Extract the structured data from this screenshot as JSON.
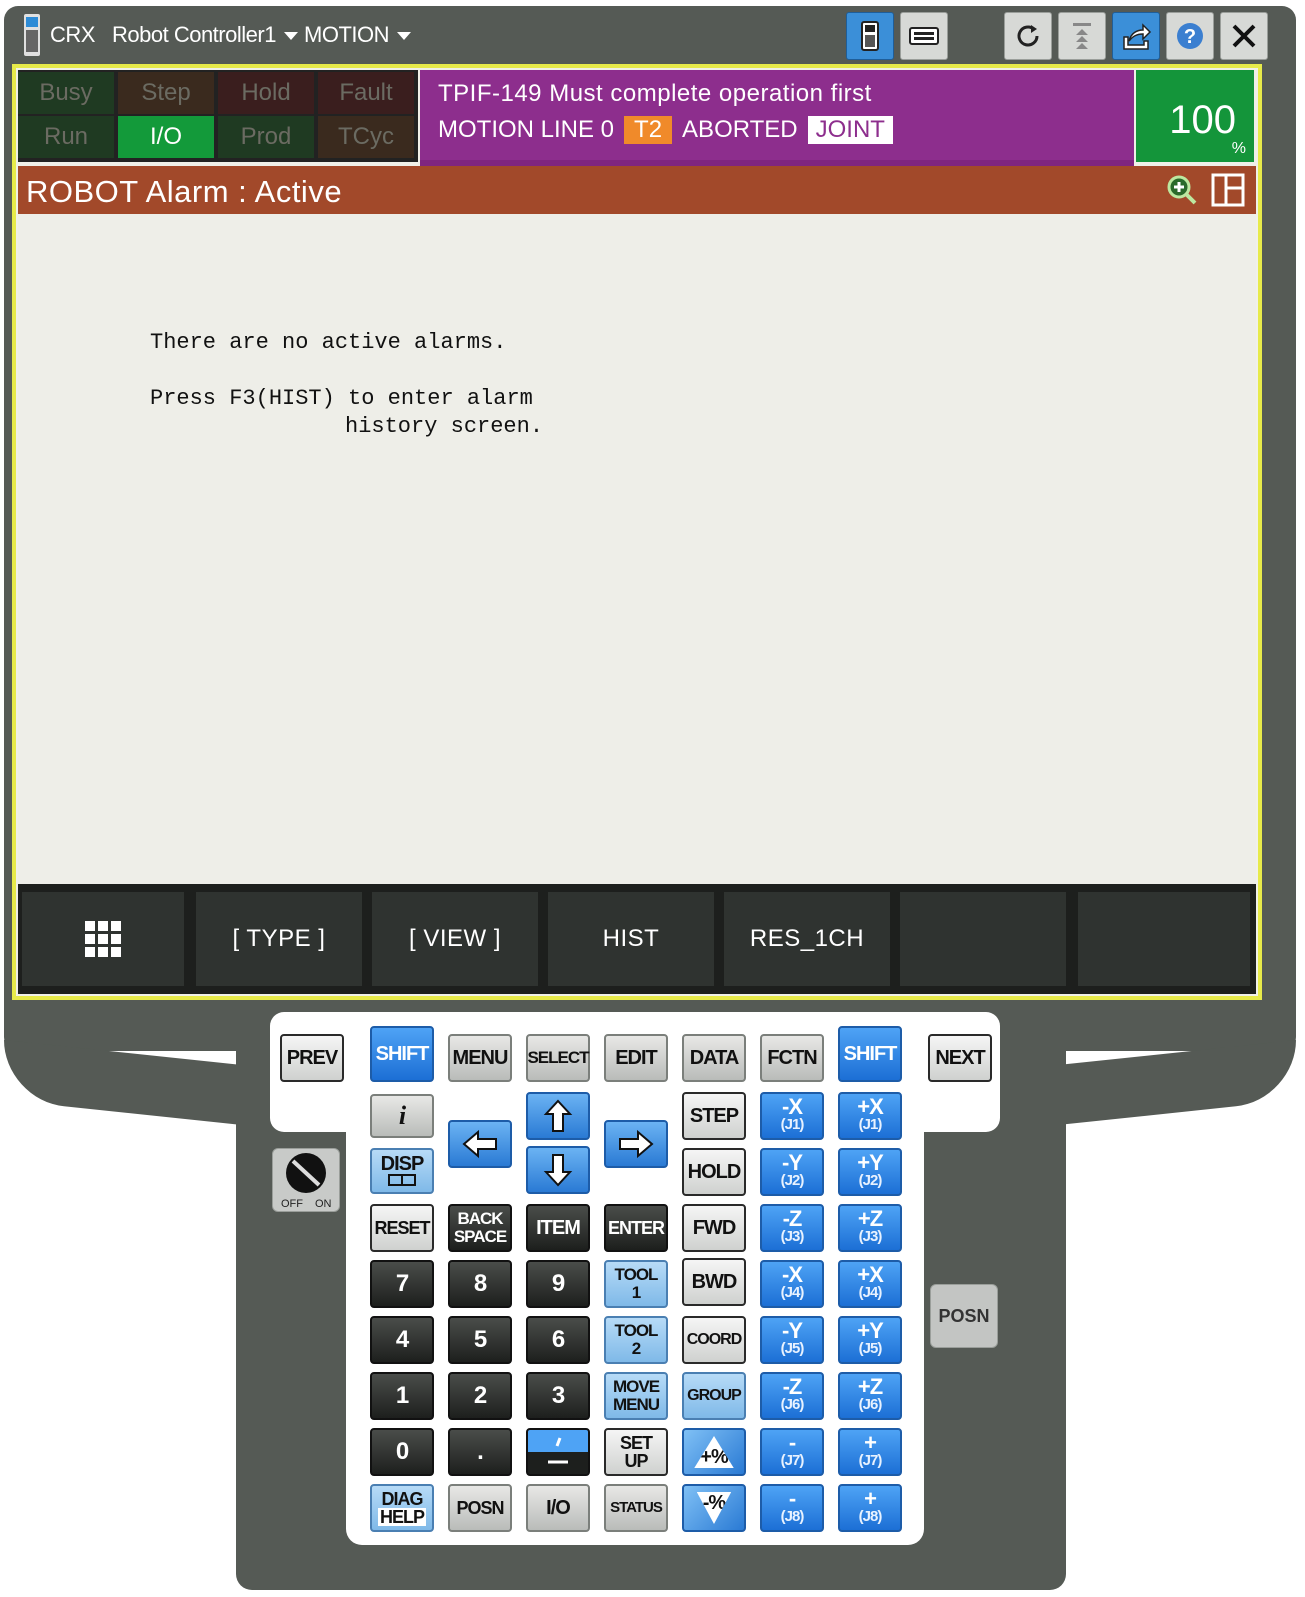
{
  "titlebar": {
    "app": "CRX",
    "controller": "Robot Controller1",
    "mode": "MOTION",
    "buttons": [
      "tp-icon",
      "keyboard-icon",
      "refresh-icon",
      "jog-icon",
      "share-icon",
      "help-icon",
      "close-icon"
    ]
  },
  "status": {
    "busy": "Busy",
    "step": "Step",
    "hold": "Hold",
    "fault": "Fault",
    "run": "Run",
    "io": "I/O",
    "prod": "Prod",
    "tcyc": "TCyc"
  },
  "message": {
    "line1": "TPIF-149 Must complete operation first",
    "motion": "MOTION LINE 0",
    "t2": "T2",
    "aborted": "ABORTED",
    "joint": "JOINT"
  },
  "override": {
    "value": "100",
    "unit": "%"
  },
  "screen": {
    "title": "ROBOT Alarm : Active",
    "line1": "There are no active alarms.",
    "line2": "Press F3(HIST) to enter alarm",
    "line3": "history screen."
  },
  "fkeys": [
    "",
    "[ TYPE ]",
    "[ VIEW ]",
    "HIST",
    "RES_1CH",
    "",
    ""
  ],
  "keys": {
    "prev": "PREV",
    "shift": "SHIFT",
    "menu": "MENU",
    "select": "SELECT",
    "edit": "EDIT",
    "data": "DATA",
    "fctn": "FCTN",
    "next": "NEXT",
    "info": "i",
    "disp": "DISP",
    "step": "STEP",
    "hold": "HOLD",
    "reset": "RESET",
    "backspace_1": "BACK",
    "backspace_2": "SPACE",
    "item": "ITEM",
    "enter": "ENTER",
    "fwd": "FWD",
    "bwd": "BWD",
    "n7": "7",
    "n8": "8",
    "n9": "9",
    "n4": "4",
    "n5": "5",
    "n6": "6",
    "n1": "1",
    "n2": "2",
    "n3": "3",
    "n0": "0",
    "dot": ".",
    "tool1_a": "TOOL",
    "tool1_b": "1",
    "tool2_a": "TOOL",
    "tool2_b": "2",
    "coord": "COORD",
    "move_a": "MOVE",
    "move_b": "MENU",
    "group": "GROUP",
    "setup_a": "SET",
    "setup_b": "UP",
    "plus_pct": "+%",
    "minus_pct": "-%",
    "diag_a": "DIAG",
    "diag_b": "HELP",
    "posn": "POSN",
    "io": "I/O",
    "status": "STATUS",
    "switch_off": "OFF",
    "switch_on": "ON",
    "posn_side": "POSN",
    "jog": [
      {
        "l": "-X",
        "s": "(J1)"
      },
      {
        "l": "+X",
        "s": "(J1)"
      },
      {
        "l": "-Y",
        "s": "(J2)"
      },
      {
        "l": "+Y",
        "s": "(J2)"
      },
      {
        "l": "-Z",
        "s": "(J3)"
      },
      {
        "l": "+Z",
        "s": "(J3)"
      },
      {
        "l": "-X",
        "s": "(J4)"
      },
      {
        "l": "+X",
        "s": "(J4)"
      },
      {
        "l": "-Y",
        "s": "(J5)"
      },
      {
        "l": "+Y",
        "s": "(J5)"
      },
      {
        "l": "-Z",
        "s": "(J6)"
      },
      {
        "l": "+Z",
        "s": "(J6)"
      },
      {
        "l": "-",
        "s": "(J7)"
      },
      {
        "l": "+",
        "s": "(J7)"
      },
      {
        "l": "-",
        "s": "(J8)"
      },
      {
        "l": "+",
        "s": "(J8)"
      }
    ]
  },
  "colors": {
    "status_on": "#139a3a",
    "message_bg": "#8d2e8d",
    "alarm_header": "#a2492a",
    "override_bg": "#14953a",
    "screen_border": "#e7ea4a"
  }
}
